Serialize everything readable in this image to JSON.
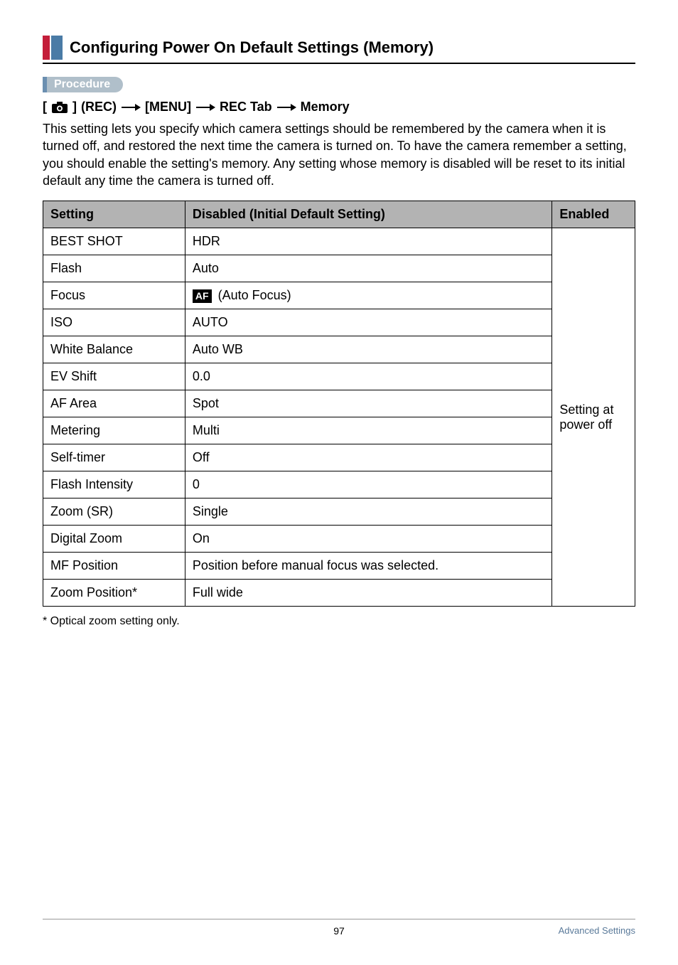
{
  "header": {
    "title": "Configuring Power On Default Settings (Memory)"
  },
  "procedure": {
    "label": "Procedure",
    "path_parts": {
      "rec": "(REC)",
      "menu": "[MENU]",
      "tab": "REC Tab",
      "target": "Memory"
    }
  },
  "description": "This setting lets you specify which camera settings should be remembered by the camera when it is turned off, and restored the next time the camera is turned on. To have the camera remember a setting, you should enable the setting's memory. Any setting whose memory is disabled will be reset to its initial default any time the camera is turned off.",
  "table": {
    "headers": {
      "setting": "Setting",
      "disabled": "Disabled (Initial Default Setting)",
      "enabled": "Enabled"
    },
    "rows": [
      {
        "setting": "BEST SHOT",
        "disabled": "HDR"
      },
      {
        "setting": "Flash",
        "disabled": "Auto"
      },
      {
        "setting": "Focus",
        "disabled_icon": "AF",
        "disabled": "(Auto Focus)"
      },
      {
        "setting": "ISO",
        "disabled": "AUTO"
      },
      {
        "setting": "White Balance",
        "disabled": "Auto WB"
      },
      {
        "setting": "EV Shift",
        "disabled": "0.0"
      },
      {
        "setting": "AF Area",
        "disabled": "Spot"
      },
      {
        "setting": "Metering",
        "disabled": "Multi"
      },
      {
        "setting": "Self-timer",
        "disabled": "Off"
      },
      {
        "setting": "Flash Intensity",
        "disabled": "0"
      },
      {
        "setting": "Zoom (SR)",
        "disabled": "Single"
      },
      {
        "setting": "Digital Zoom",
        "disabled": "On"
      },
      {
        "setting": "MF Position",
        "disabled": "Position before manual focus was selected."
      },
      {
        "setting": "Zoom Position*",
        "disabled": "Full wide"
      }
    ],
    "enabled_text": "Setting at power off"
  },
  "footnote": "* Optical zoom setting only.",
  "footer": {
    "page": "97",
    "section": "Advanced Settings"
  }
}
